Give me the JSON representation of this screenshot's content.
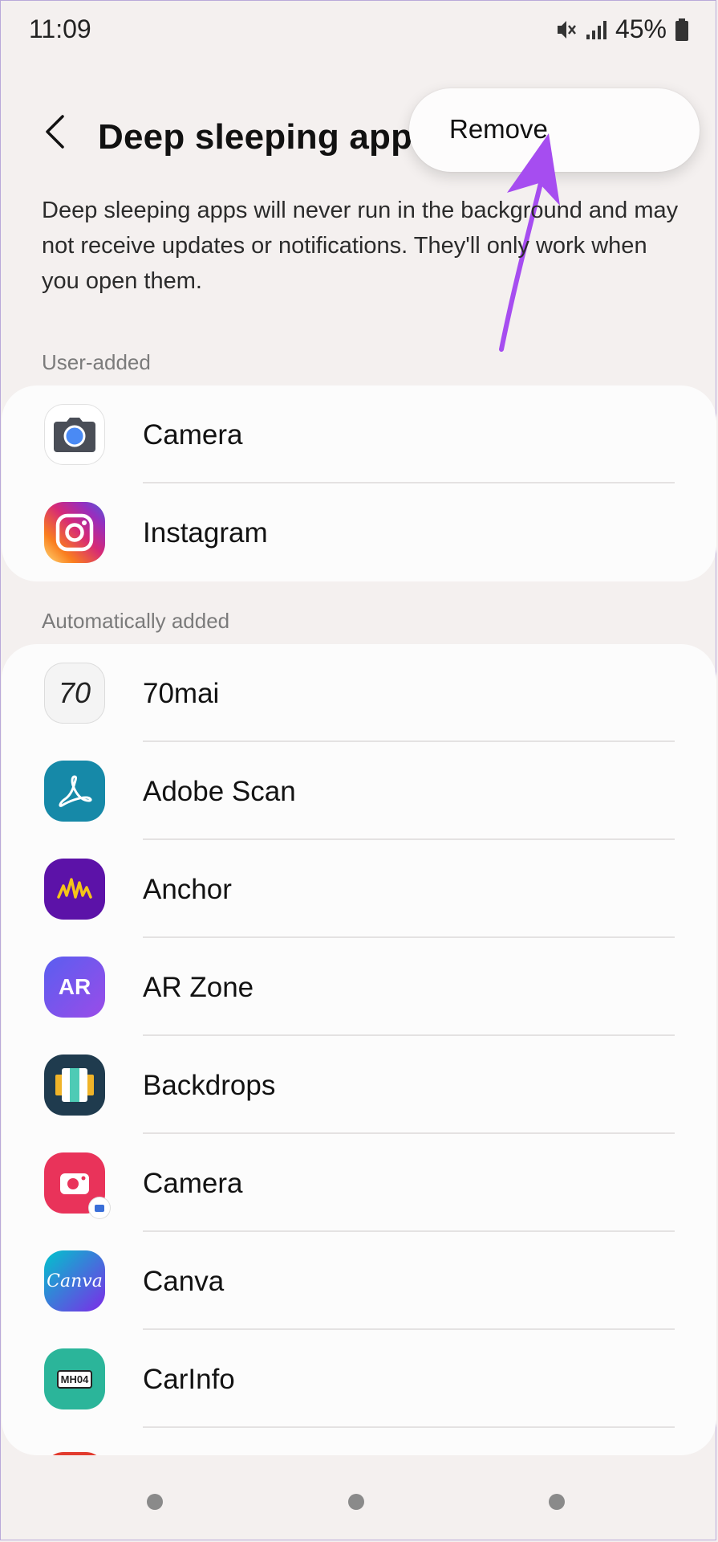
{
  "status_bar": {
    "time": "11:09",
    "battery": "45%",
    "icons": [
      "mute-icon",
      "signal-icon",
      "battery-icon"
    ]
  },
  "header": {
    "back_icon": "back-arrow-icon",
    "title": "Deep sleeping apps"
  },
  "menu": {
    "remove_label": "Remove"
  },
  "description": "Deep sleeping apps will never run in the background and may not receive updates or notifications. They'll only work when you open them.",
  "sections": {
    "user_added": {
      "label": "User-added",
      "apps": [
        {
          "name": "Camera",
          "icon": "google-camera-icon"
        },
        {
          "name": "Instagram",
          "icon": "instagram-icon"
        }
      ]
    },
    "auto_added": {
      "label": "Automatically added",
      "apps": [
        {
          "name": "70mai",
          "icon": "70mai-icon",
          "icon_text": "70"
        },
        {
          "name": "Adobe Scan",
          "icon": "adobe-scan-icon"
        },
        {
          "name": "Anchor",
          "icon": "anchor-icon"
        },
        {
          "name": "AR Zone",
          "icon": "ar-zone-icon",
          "icon_text": "AR"
        },
        {
          "name": "Backdrops",
          "icon": "backdrops-icon"
        },
        {
          "name": "Camera",
          "icon": "samsung-camera-icon"
        },
        {
          "name": "Canva",
          "icon": "canva-icon",
          "icon_text": "Canva"
        },
        {
          "name": "CarInfo",
          "icon": "carinfo-icon",
          "icon_text": "MH04"
        }
      ]
    }
  },
  "colors": {
    "background": "#f4f0ef",
    "card": "#fcfcfc",
    "annotation_arrow": "#a64df0"
  }
}
